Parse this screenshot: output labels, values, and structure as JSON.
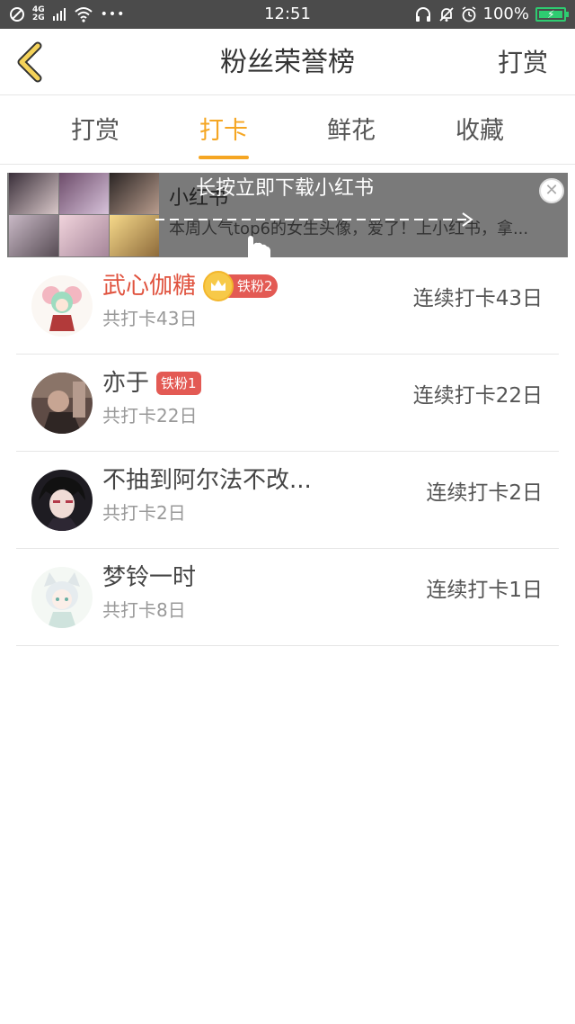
{
  "status_bar": {
    "network_top": "4G",
    "network_bottom": "2G",
    "dots": "•••",
    "time": "12:51",
    "battery": "100%",
    "icons": [
      "block-icon",
      "signal-icon",
      "wifi-icon",
      "headset-icon",
      "bell-off-icon",
      "alarm-icon",
      "battery-icon"
    ]
  },
  "header": {
    "title": "粉丝荣誉榜",
    "action": "打赏"
  },
  "tabs": [
    {
      "label": "打赏"
    },
    {
      "label": "打卡"
    },
    {
      "label": "鲜花"
    },
    {
      "label": "收藏"
    }
  ],
  "active_tab": 1,
  "ad": {
    "title": "小红书",
    "desc": "本周人气top6的女生头像，爱了！上小红书，拿...",
    "banner": "长按立即下载小红书",
    "close": "✕"
  },
  "list": [
    {
      "name": "武心伽糖",
      "badge": "铁粉2",
      "crown": true,
      "total": "共打卡43日",
      "streak": "连续打卡43日"
    },
    {
      "name": "亦于",
      "badge": "铁粉1",
      "crown": false,
      "total": "共打卡22日",
      "streak": "连续打卡22日"
    },
    {
      "name": "不抽到阿尔法不改...",
      "badge": "",
      "crown": false,
      "total": "共打卡2日",
      "streak": "连续打卡2日"
    },
    {
      "name": "梦铃一时",
      "badge": "",
      "crown": false,
      "total": "共打卡8日",
      "streak": "连续打卡1日"
    }
  ],
  "colors": {
    "accent": "#f5a623",
    "name_highlight": "#e0533f",
    "badge": "#e35a54",
    "status_bar": "#4b4b4b"
  }
}
